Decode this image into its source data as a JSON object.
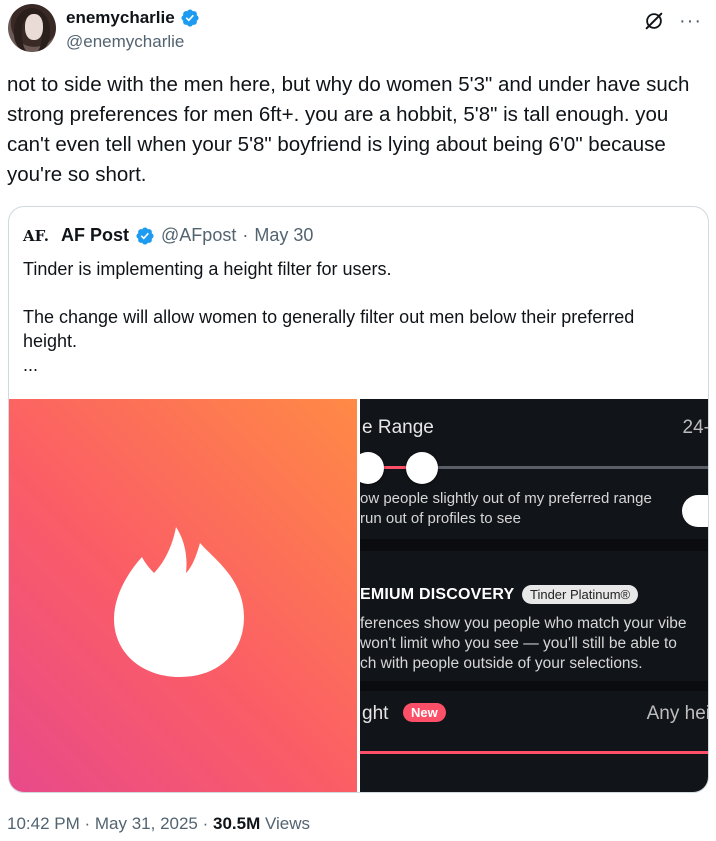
{
  "author": {
    "display_name": "enemycharlie",
    "handle": "@enemycharlie",
    "verified": true
  },
  "tweet": {
    "text": "not to side with the men here, but why do women 5'3\" and under have such strong preferences for men 6ft+. you are a hobbit, 5'8\" is tall enough. you can't even tell when your 5'8\" boyfriend is lying about being 6'0\" because you're so short."
  },
  "quote": {
    "logo": "AF.",
    "name": "AF Post",
    "handle": "@AFpost",
    "dot": "·",
    "date": "May 30",
    "text": "Tinder is implementing a height filter for users.\n\nThe change will allow women to generally filter out men below their preferred height.\n...",
    "media": {
      "left_icon": "tinder-flame-icon",
      "right": {
        "range_label": "e Range",
        "age_value": "24-",
        "pref_text": "ow people slightly out of my preferred range\nrun out of profiles to see",
        "premium_label": "EMIUM DISCOVERY",
        "platinum_badge": "Tinder Platinum®",
        "desc_text": "ferences show you people who match your vibe\nwon't limit who you see — you'll still be able to\nch with people outside of your selections.",
        "height_label": "ght",
        "new_badge": "New",
        "any_height": "Any hei"
      }
    }
  },
  "footer": {
    "time": "10:42 PM · May 31, 2025 · ",
    "views_count": "30.5M",
    "views_label": " Views"
  },
  "colors": {
    "verified_blue": "#1d9bf0",
    "tinder_red": "#fd5068",
    "muted": "#536471"
  }
}
